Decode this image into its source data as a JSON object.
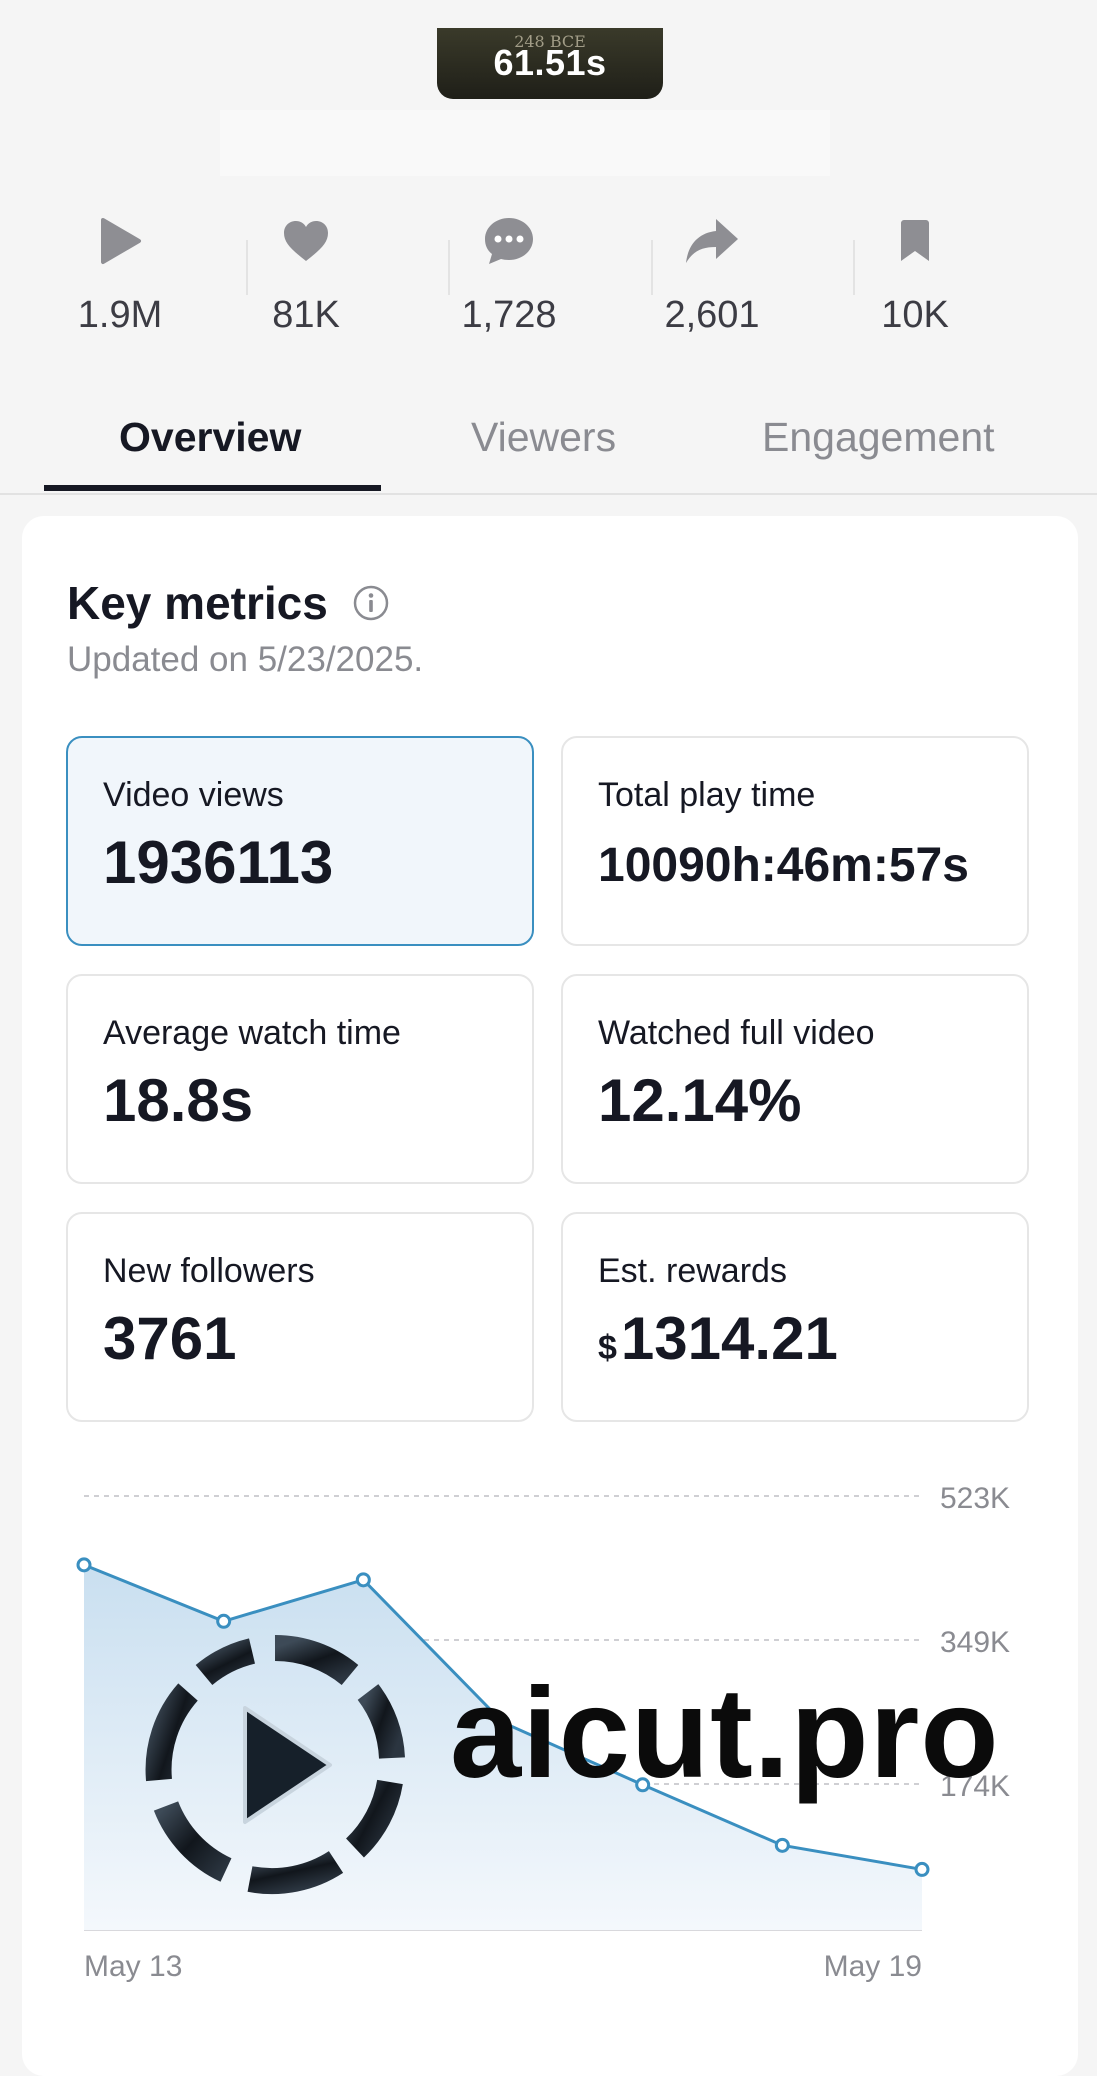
{
  "video": {
    "thumbnail_era": "248 BCE",
    "duration": "61.51s"
  },
  "stats": [
    {
      "icon": "play-icon",
      "value": "1.9M"
    },
    {
      "icon": "heart-icon",
      "value": "81K"
    },
    {
      "icon": "comment-icon",
      "value": "1,728"
    },
    {
      "icon": "share-icon",
      "value": "2,601"
    },
    {
      "icon": "bookmark-icon",
      "value": "10K"
    }
  ],
  "tabs": [
    {
      "label": "Overview",
      "active": true
    },
    {
      "label": "Viewers",
      "active": false
    },
    {
      "label": "Engagement",
      "active": false
    }
  ],
  "key_metrics": {
    "title": "Key metrics",
    "updated": "Updated on 5/23/2025.",
    "metrics": [
      {
        "label": "Video views",
        "value": "1936113",
        "selected": true
      },
      {
        "label": "Total play time",
        "value": "10090h:46m:57s"
      },
      {
        "label": "Average watch time",
        "value": "18.8s"
      },
      {
        "label": "Watched full video",
        "value": "12.14%"
      },
      {
        "label": "New followers",
        "value": "3761"
      },
      {
        "label": "Est. rewards",
        "currency": "$",
        "value": "1314.21"
      }
    ]
  },
  "chart_data": {
    "type": "area",
    "x": [
      "May 13",
      "May 14",
      "May 15",
      "May 16",
      "May 17",
      "May 18",
      "May 19"
    ],
    "x_tick_labels": [
      "May 13",
      "May 19"
    ],
    "y_tick_labels": [
      "523K",
      "349K",
      "174K"
    ],
    "values": [
      440000,
      372000,
      422000,
      250000,
      175000,
      102000,
      73000
    ],
    "ylim": [
      0,
      523000
    ],
    "grid": true,
    "color": "#3a8fc0"
  },
  "watermark": {
    "text": "aicut.pro"
  }
}
